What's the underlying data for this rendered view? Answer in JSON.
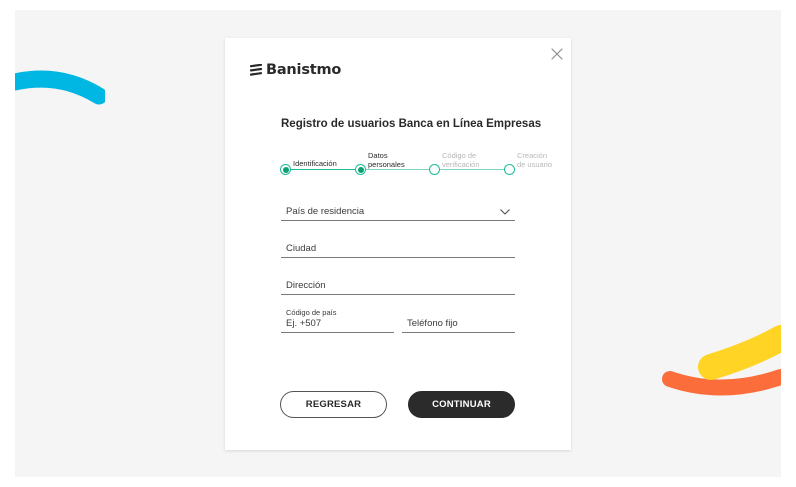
{
  "brand": {
    "name": "Banistmo"
  },
  "form": {
    "title": "Registro de usuarios Banca en Línea Empresas",
    "steps": [
      {
        "label": "Identificación",
        "state": "done"
      },
      {
        "label_line1": "Datos",
        "label_line2": "personales",
        "state": "current"
      },
      {
        "label_line1": "Código de",
        "label_line2": "verificación",
        "state": "pending"
      },
      {
        "label_line1": "Creación",
        "label_line2": "de usuario",
        "state": "pending"
      }
    ],
    "fields": {
      "country_residence": "País de residencia",
      "city": "Ciudad",
      "address": "Dirección",
      "country_code_label": "Código de país",
      "country_code_placeholder": "Ej. +507",
      "landline": "Teléfono fijo"
    },
    "buttons": {
      "back": "REGRESAR",
      "continue": "CONTINUAR"
    }
  },
  "colors": {
    "step_accent": "#1abc9c",
    "step_fill": "#0d9f6f",
    "deco_cyan": "#00b7e4",
    "deco_orange": "#fb6e3c",
    "deco_yellow": "#ffd424",
    "primary_button": "#2b2b2b"
  },
  "icons": [
    "close-icon",
    "chevron-down-icon",
    "banistmo-logo-icon"
  ]
}
